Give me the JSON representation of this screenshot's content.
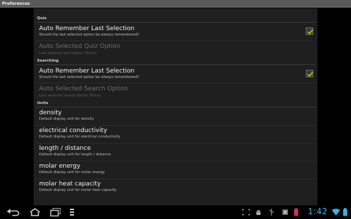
{
  "app": {
    "title": "Preferences"
  },
  "sections": {
    "quiz": {
      "header": "Quiz",
      "auto_remember": {
        "title": "Auto Remember Last Selection",
        "summary": "Should the last selected option be always remembered?",
        "checked": true
      },
      "auto_selected": {
        "title": "Auto Selected Quiz Option",
        "summary": "Last selected quiz option (None)"
      }
    },
    "searching": {
      "header": "Searching",
      "auto_remember": {
        "title": "Auto Remember Last Selection",
        "summary": "Should the last selected option be always remembered?",
        "checked": true
      },
      "auto_selected": {
        "title": "Auto Selected Search Option",
        "summary": "Last selected search option (None)"
      }
    },
    "units": {
      "header": "Units",
      "items": [
        {
          "title": "density",
          "summary": "Default display unit for density"
        },
        {
          "title": "electrical conductivity",
          "summary": "Default display unit for electrical conductivity"
        },
        {
          "title": "length / distance",
          "summary": "Default display unit for length / distance"
        },
        {
          "title": "molar energy",
          "summary": "Default display unit for molar energy"
        },
        {
          "title": "molar heat capacity",
          "summary": "Default display unit for molar heat capacity"
        }
      ]
    }
  },
  "status_bar": {
    "time": "1:42"
  },
  "colors": {
    "accent": "#33b5e5",
    "check": "#99cc00",
    "panel": "#1f1f1f"
  },
  "icons": [
    "back-icon",
    "home-icon",
    "recent-apps-icon",
    "menu-icon",
    "screenshot-icon",
    "android-debug-icon",
    "usb-icon",
    "app-notification-icon",
    "wifi-icon",
    "battery-icon"
  ]
}
